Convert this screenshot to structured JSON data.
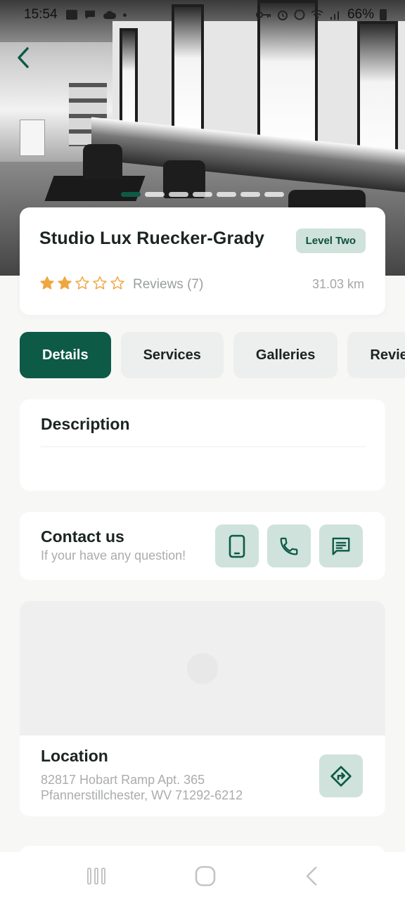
{
  "status_bar": {
    "time": "15:54",
    "battery": "66%",
    "left_icons": [
      "image-icon",
      "chat-bubble-icon",
      "cloud-icon",
      "dot-icon"
    ],
    "right_icons": [
      "key-icon",
      "alarm-icon",
      "clock-icon",
      "wifi-icon",
      "signal-icon",
      "battery-icon"
    ]
  },
  "hero": {
    "carousel_count": 7,
    "active_index": 0
  },
  "salon": {
    "name": "Studio Lux Ruecker-Grady",
    "level": "Level Two",
    "rating": 2,
    "max_rating": 5,
    "reviews": "Reviews (7)",
    "distance": "31.03 km"
  },
  "tabs": [
    {
      "label": "Details",
      "active": true
    },
    {
      "label": "Services",
      "active": false
    },
    {
      "label": "Galleries",
      "active": false
    },
    {
      "label": "Reviews",
      "active": false
    }
  ],
  "description": {
    "title": "Description"
  },
  "contact": {
    "title": "Contact us",
    "subtitle": "If your have any question!"
  },
  "location": {
    "title": "Location",
    "address_line1": "82817 Hobart Ramp Apt. 365",
    "address_line2": "Pfannerstillchester, WV 71292-6212"
  },
  "colors": {
    "primary": "#0d5a46",
    "primary_light": "#cfe2dc",
    "star": "#f0a640",
    "muted_text": "#a9adab"
  }
}
